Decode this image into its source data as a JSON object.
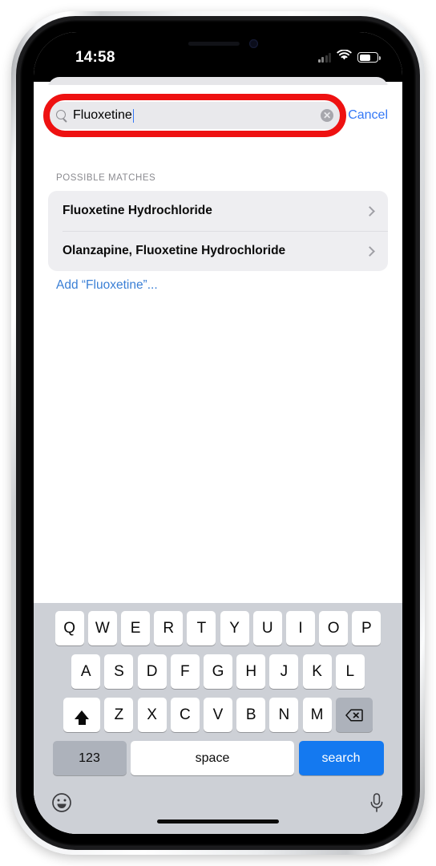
{
  "device": {
    "frame": "iphone",
    "buttons": [
      "mute-switch",
      "volume-up",
      "volume-down",
      "power"
    ]
  },
  "status_bar": {
    "time": "14:58",
    "cellular_icon": "signal-bars-icon",
    "wifi_icon": "wifi-icon",
    "battery_icon": "battery-icon",
    "battery_fill_percent": 58
  },
  "search": {
    "value": "Fluoxetine",
    "placeholder": "Search",
    "search_icon": "search-icon",
    "clear_icon": "clear-circle-icon",
    "clear_glyph": "✕",
    "cancel_label": "Cancel",
    "highlight_color": "#ee1111",
    "accent_color": "#3478f6"
  },
  "results": {
    "section_label": "POSSIBLE MATCHES",
    "items": [
      {
        "label": "Fluoxetine Hydrochloride",
        "chevron": "chevron-right-icon"
      },
      {
        "label": "Olanzapine, Fluoxetine Hydrochloride",
        "chevron": "chevron-right-icon"
      }
    ],
    "add_link": "Add “Fluoxetine”..."
  },
  "keyboard": {
    "row1": [
      "Q",
      "W",
      "E",
      "R",
      "T",
      "Y",
      "U",
      "I",
      "O",
      "P"
    ],
    "row2": [
      "A",
      "S",
      "D",
      "F",
      "G",
      "H",
      "J",
      "K",
      "L"
    ],
    "row3_letters": [
      "Z",
      "X",
      "C",
      "V",
      "B",
      "N",
      "M"
    ],
    "shift_icon": "shift-arrow-icon",
    "backspace_icon": "backspace-icon",
    "numeric_label": "123",
    "space_label": "space",
    "return_label": "search",
    "emoji_icon": "emoji-smiley-icon",
    "dictation_icon": "microphone-icon",
    "return_key_color": "#1479f0"
  }
}
